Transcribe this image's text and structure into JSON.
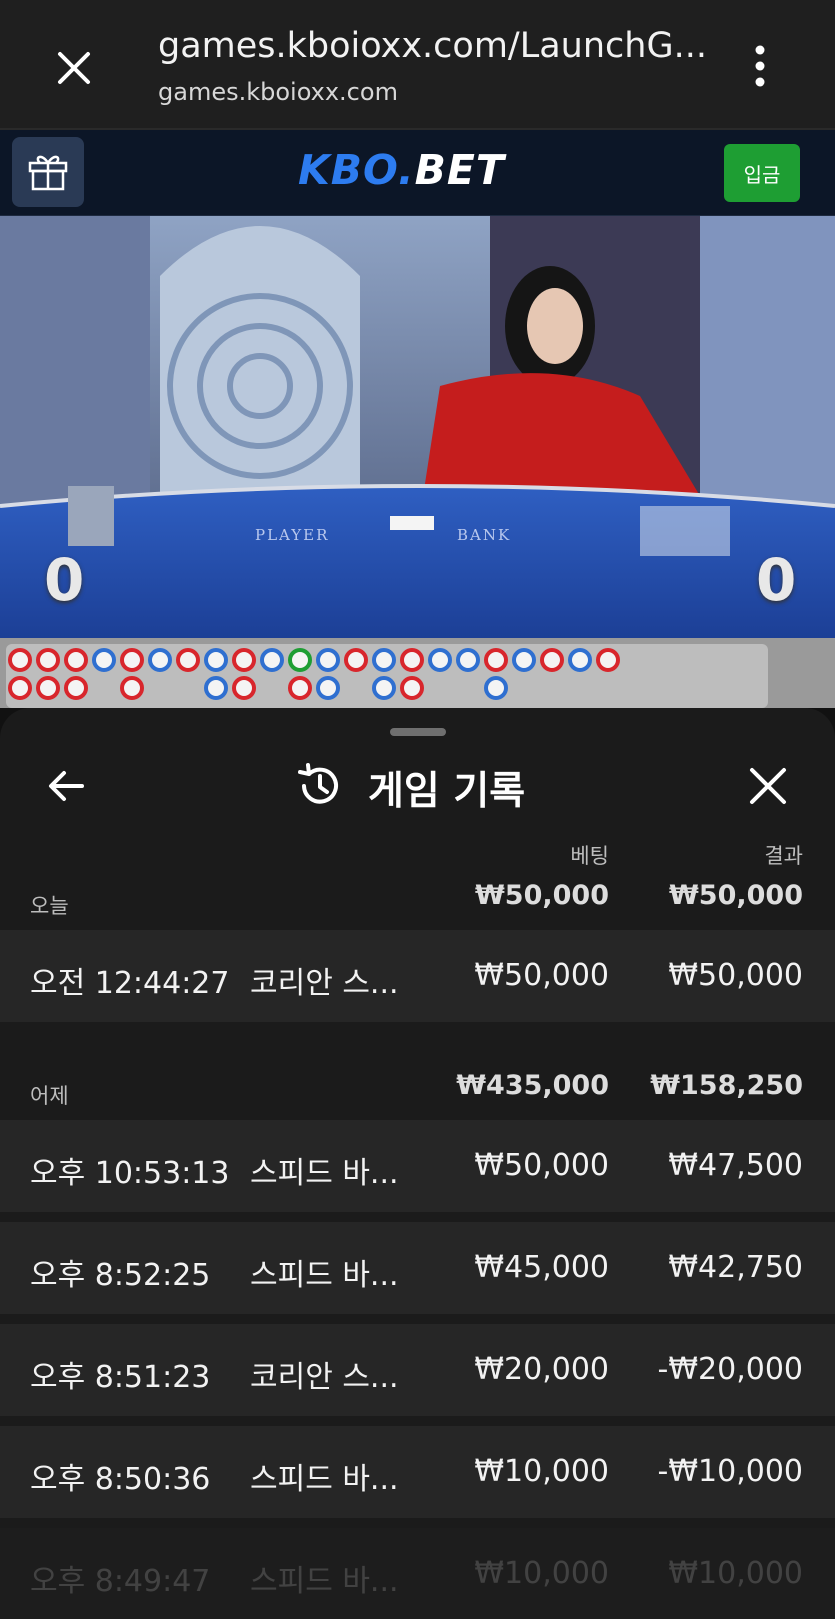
{
  "browser": {
    "url_title": "games.kboioxx.com/LaunchG...",
    "url_host": "games.kboioxx.com"
  },
  "site": {
    "logo_part1": "KBO.",
    "logo_part2": "BET",
    "deposit_label": "입금"
  },
  "video": {
    "player_score": "0",
    "banker_score": "0",
    "table_player": "PLAYER",
    "table_banker": "BANK"
  },
  "sheet": {
    "title": "게임 기록",
    "col_bet": "베팅",
    "col_result": "결과",
    "groups": [
      {
        "label": "오늘",
        "bet_total": "₩50,000",
        "result_total": "₩50,000",
        "rows": [
          {
            "time": "오전 12:44:27",
            "game": "코리안 스...",
            "bet": "₩50,000",
            "result": "₩50,000"
          }
        ]
      },
      {
        "label": "어제",
        "bet_total": "₩435,000",
        "result_total": "₩158,250",
        "rows": [
          {
            "time": "오후 10:53:13",
            "game": "스피드 바...",
            "bet": "₩50,000",
            "result": "₩47,500"
          },
          {
            "time": "오후 8:52:25",
            "game": "스피드 바...",
            "bet": "₩45,000",
            "result": "₩42,750"
          },
          {
            "time": "오후 8:51:23",
            "game": "코리안 스...",
            "bet": "₩20,000",
            "result": "-₩20,000"
          },
          {
            "time": "오후 8:50:36",
            "game": "스피드 바...",
            "bet": "₩10,000",
            "result": "-₩10,000"
          },
          {
            "time": "오후 8:49:47",
            "game": "스피드 바...",
            "bet": "₩10,000",
            "result": "₩10,000"
          }
        ]
      }
    ]
  },
  "colors": {
    "deposit_green": "#1e9e33",
    "logo_blue": "#2d7cf0",
    "sheet_bg": "#1b1b1b",
    "row_bg": "#262626"
  }
}
